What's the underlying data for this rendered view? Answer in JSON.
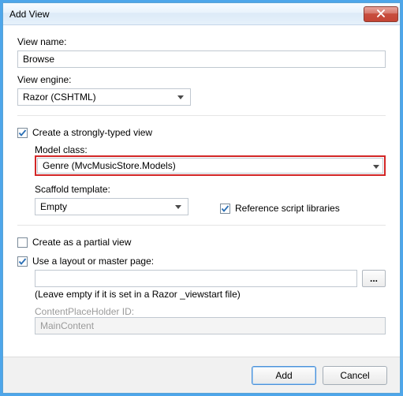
{
  "window": {
    "title": "Add View"
  },
  "labels": {
    "viewName": "View name:",
    "viewEngine": "View engine:",
    "stronglyTyped": "Create a strongly-typed view",
    "modelClass": "Model class:",
    "scaffoldTemplate": "Scaffold template:",
    "referenceScripts": "Reference script libraries",
    "partialView": "Create as a partial view",
    "useLayout": "Use a layout or master page:",
    "layoutHint": "(Leave empty if it is set in a Razor _viewstart file)",
    "cphId": "ContentPlaceHolder ID:"
  },
  "values": {
    "viewName": "Browse",
    "viewEngine": "Razor (CSHTML)",
    "modelClass": "Genre (MvcMusicStore.Models)",
    "scaffoldTemplate": "Empty",
    "layoutPath": "",
    "cphId": "MainContent"
  },
  "checks": {
    "stronglyTyped": true,
    "referenceScripts": true,
    "partialView": false,
    "useLayout": true
  },
  "buttons": {
    "browse": "...",
    "add": "Add",
    "cancel": "Cancel"
  }
}
